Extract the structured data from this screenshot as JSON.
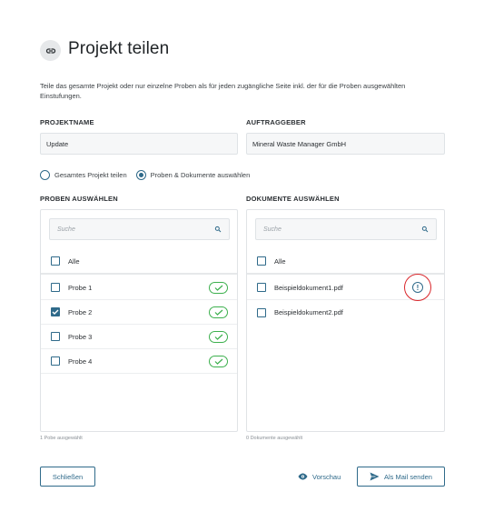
{
  "header": {
    "title": "Projekt teilen",
    "icon": "link-icon"
  },
  "description": "Teile das gesamte Projekt oder nur einzelne Proben als für jeden zugängliche Seite inkl. der für die Proben ausgewählten Einstufungen.",
  "fields": {
    "project_name": {
      "label": "PROJEKTNAME",
      "value": "Update"
    },
    "client": {
      "label": "AUFTRAGGEBER",
      "value": "Mineral Waste Manager GmbH"
    }
  },
  "share_mode": {
    "options": [
      "Gesamtes Projekt teilen",
      "Proben & Dokumente auswählen"
    ],
    "selected": "Proben & Dokumente auswählen"
  },
  "samples": {
    "label": "PROBEN AUSWÄHLEN",
    "search_placeholder": "Suche",
    "all_label": "Alle",
    "items": [
      {
        "label": "Probe 1",
        "checked": false,
        "status": "check-icon"
      },
      {
        "label": "Probe 2",
        "checked": true,
        "status": "check-icon"
      },
      {
        "label": "Probe 3",
        "checked": false,
        "status": "check-icon"
      },
      {
        "label": "Probe 4",
        "checked": false,
        "status": "check-icon"
      }
    ],
    "count_text": "1 Pobe ausgewählt"
  },
  "documents": {
    "label": "DOKUMENTE AUSWÄHLEN",
    "search_placeholder": "Suche",
    "all_label": "Alle",
    "items": [
      {
        "label": "Beispieldokument1.pdf",
        "checked": false,
        "warning": true
      },
      {
        "label": "Beispieldokument2.pdf",
        "checked": false,
        "warning": false
      }
    ],
    "count_text": "0 Dokumente ausgewählt"
  },
  "footer": {
    "close_label": "Schließen",
    "preview_label": "Vorschau",
    "send_label": "Als Mail senden"
  },
  "colors": {
    "accent": "#2f6a8a",
    "success": "#3db04e",
    "warning_ring": "#d9262b"
  }
}
